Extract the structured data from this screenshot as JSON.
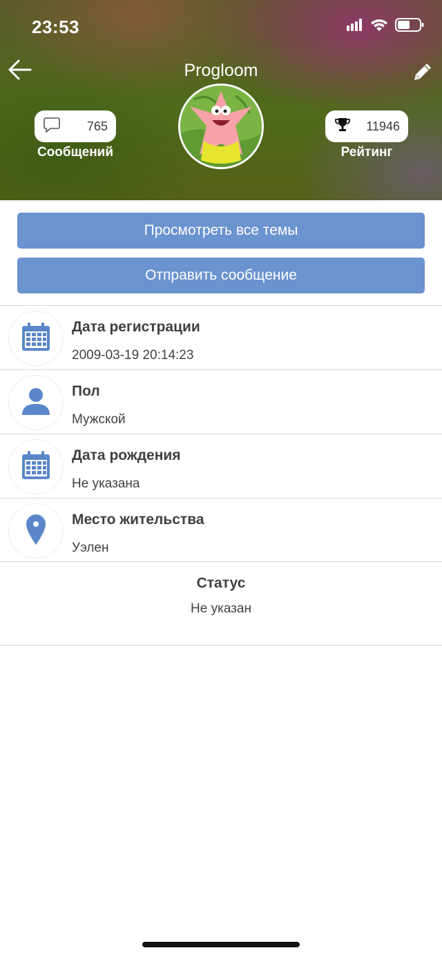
{
  "status_bar": {
    "time": "23:53"
  },
  "profile": {
    "username": "Progloom",
    "messages": {
      "count": "765",
      "label": "Сообщений"
    },
    "rating": {
      "value": "11946",
      "label": "Рейтинг"
    }
  },
  "actions": {
    "view_topics": "Просмотреть все темы",
    "send_message": "Отправить сообщение"
  },
  "info": [
    {
      "title": "Дата регистрации",
      "value": "2009-03-19 20:14:23",
      "icon": "calendar-icon"
    },
    {
      "title": "Пол",
      "value": "Мужской",
      "icon": "person-icon"
    },
    {
      "title": "Дата рождения",
      "value": "Не указана",
      "icon": "calendar-icon"
    },
    {
      "title": "Место жительства",
      "value": "Уэлен",
      "icon": "location-pin-icon"
    }
  ],
  "status": {
    "title": "Статус",
    "value": "Не указан"
  },
  "colors": {
    "accent": "#6b93cf",
    "icon": "#5b86c9"
  }
}
